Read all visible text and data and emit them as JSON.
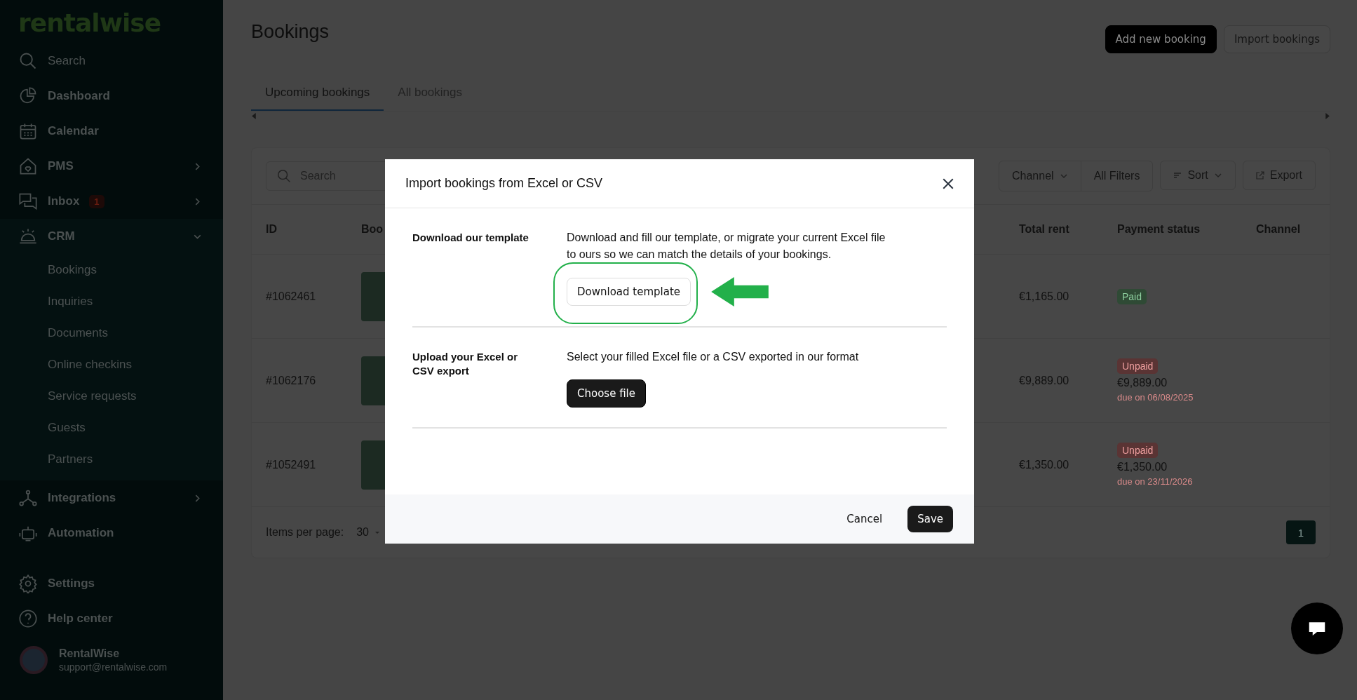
{
  "sidebar": {
    "logo": "rentalwise",
    "search": {
      "placeholder": "Search"
    },
    "items": [
      {
        "label": "Dashboard"
      },
      {
        "label": "Calendar"
      },
      {
        "label": "PMS",
        "expanded": false
      },
      {
        "label": "Inbox",
        "expanded": false,
        "badge": "1"
      },
      {
        "label": "CRM",
        "expanded": true,
        "children": [
          {
            "label": "Bookings"
          },
          {
            "label": "Inquiries"
          },
          {
            "label": "Documents"
          },
          {
            "label": "Online checkins"
          },
          {
            "label": "Service requests"
          },
          {
            "label": "Guests"
          },
          {
            "label": "Partners"
          }
        ]
      },
      {
        "label": "Integrations",
        "expanded": false
      },
      {
        "label": "Automation"
      }
    ],
    "bottom_items": [
      {
        "label": "Settings"
      },
      {
        "label": "Help center"
      }
    ],
    "user": {
      "name": "RentalWise",
      "email": "support@rentalwise.com"
    }
  },
  "page": {
    "title": "Bookings",
    "buttons": [
      {
        "label": "Add new booking",
        "kind": "primary"
      },
      {
        "label": "Import bookings",
        "kind": "secondary"
      }
    ],
    "tabs": [
      {
        "label": "Upcoming bookings",
        "selected": true
      },
      {
        "label": "All bookings",
        "selected": false
      }
    ]
  },
  "toolbar": {
    "search": {
      "placeholder": "Search"
    },
    "filters": [
      {
        "label": "Channel",
        "kind": "dropdown"
      },
      {
        "label": "All Filters",
        "kind": "plain"
      }
    ],
    "sort": "Sort",
    "export": "Export"
  },
  "table": {
    "columns": [
      "ID",
      "Boo",
      "Total rent",
      "Payment status",
      "Channel"
    ],
    "rows": [
      {
        "id": "#1062461",
        "total_rent": "€1,165.00",
        "status": "Paid",
        "paid": true
      },
      {
        "id": "#1062176",
        "total_rent": "€9,889.00",
        "status": "Unpaid",
        "paid": false,
        "amount": "€9,889.00",
        "due": "due on 06/08/2025"
      },
      {
        "id": "#1052491",
        "total_rent": "€1,350.00",
        "status": "Unpaid",
        "paid": false,
        "amount": "€1,350.00",
        "due": "due on 23/11/2026"
      }
    ],
    "footer": {
      "items_per_page_label": "Items per page:",
      "items_per_page": "30",
      "page": "1"
    }
  },
  "modal": {
    "title": "Import bookings from Excel or CSV",
    "sections": [
      {
        "heading": "Download our template",
        "text": "Download and fill our template, or migrate your current Excel file to ours so we can match the details of your bookings.",
        "button": "Download template",
        "kind": "outline",
        "highlighted": true
      },
      {
        "heading": "Upload your Excel or CSV export",
        "text": "Select your filled Excel file or a CSV exported in our format",
        "button": "Choose file",
        "kind": "dark"
      }
    ],
    "cancel": "Cancel",
    "save": "Save"
  }
}
